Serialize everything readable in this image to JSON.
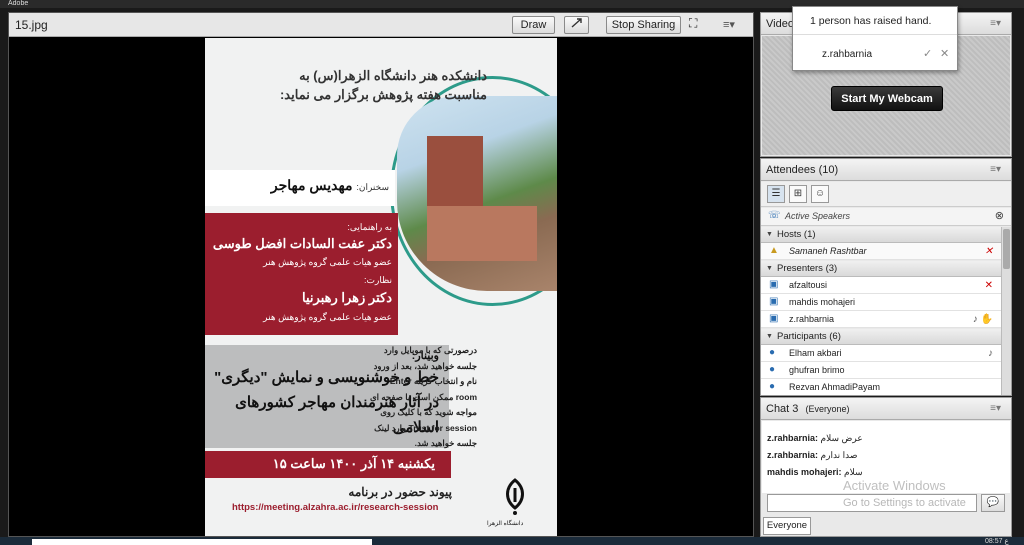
{
  "app": {
    "title": "Adobe"
  },
  "share": {
    "file_name": "15.jpg",
    "draw_label": "Draw",
    "sync_icon": "sync-icon",
    "stop_label": "Stop Sharing",
    "fullscreen_icon": "⛶",
    "menu_icon": "≡▾"
  },
  "poster": {
    "header": "دانشکده هنر دانشگاه الزهرا(س) به مناسبت هفته پژوهش برگزار می نماید:",
    "speaker_label": "سخنران:",
    "speaker": "مهدیس مهاجر",
    "advisor_label": "به راهنمایی:",
    "advisor": "دکتر عفت السادات افضل طوسی",
    "advisor_role": "عضو هیات علمی گروه پژوهش هنر",
    "supervisor_label": "نظارت:",
    "supervisor": "دکتر زهرا رهبرنیا",
    "supervisor_role": "عضو هیات علمی گروه پژوهش هنر",
    "webinar_label": "وبینار:",
    "webinar_title": "خط و خوشنویسی و نمایش \"دیگری\" در آثار هنرمندان مهاجر کشورهای اسلامی",
    "info": "درصورتی که با موبایل وارد جلسه خواهید شد، بعد از ورود نام و انتخاب گزینه Enter room ممکن است با صفحه ای مواجه شوید که با کلیک روی Trust for session وارد لینک جلسه خواهید شد.",
    "date": "یکشنبه ۱۴ آذر ۱۴۰۰ ساعت ۱۵",
    "join": "پیوند حضور در برنامه",
    "url": "https://meeting.alzahra.ac.ir/research-session",
    "logo_text": "دانشگاه الزهرا"
  },
  "video": {
    "title": "Video",
    "webcam_label": "Start My Webcam"
  },
  "raise_hand": {
    "message": "1 person has raised hand.",
    "name": "z.rahbarnia",
    "accept_icon": "✓",
    "dismiss_icon": "✕"
  },
  "attendees": {
    "title": "Attendees",
    "count": "(10)",
    "active_label": "Active Speakers",
    "groups": [
      {
        "label": "Hosts (1)",
        "rows": [
          {
            "name": "Samaneh Rashtbar",
            "status": "mic-off-icon"
          }
        ]
      },
      {
        "label": "Presenters (3)",
        "rows": [
          {
            "name": "afzaltousi",
            "status": "mic-off-icon"
          },
          {
            "name": "mahdis mohajeri",
            "status": ""
          },
          {
            "name": "z.rahbarnia",
            "status": "mic-raise-icon"
          }
        ]
      },
      {
        "label": "Participants (6)",
        "rows": [
          {
            "name": "Elham akbari",
            "status": "mic-icon"
          },
          {
            "name": "ghufran brimo",
            "status": ""
          },
          {
            "name": "Rezvan AhmadiPayam",
            "status": ""
          }
        ]
      }
    ]
  },
  "chat": {
    "title": "Chat 3",
    "scope": "(Everyone)",
    "messages": [
      {
        "sender": "z.rahbarnia:",
        "text": "عرض سلام"
      },
      {
        "sender": "z.rahbarnia:",
        "text": "صدا ندارم"
      },
      {
        "sender": "mahdis mohajeri:",
        "text": "سلام"
      }
    ],
    "recipient_tab": "Everyone"
  },
  "os": {
    "watermark_line1": "Activate Windows",
    "watermark_line2": "Go to Settings to activate",
    "clock": "08:57 ع"
  }
}
